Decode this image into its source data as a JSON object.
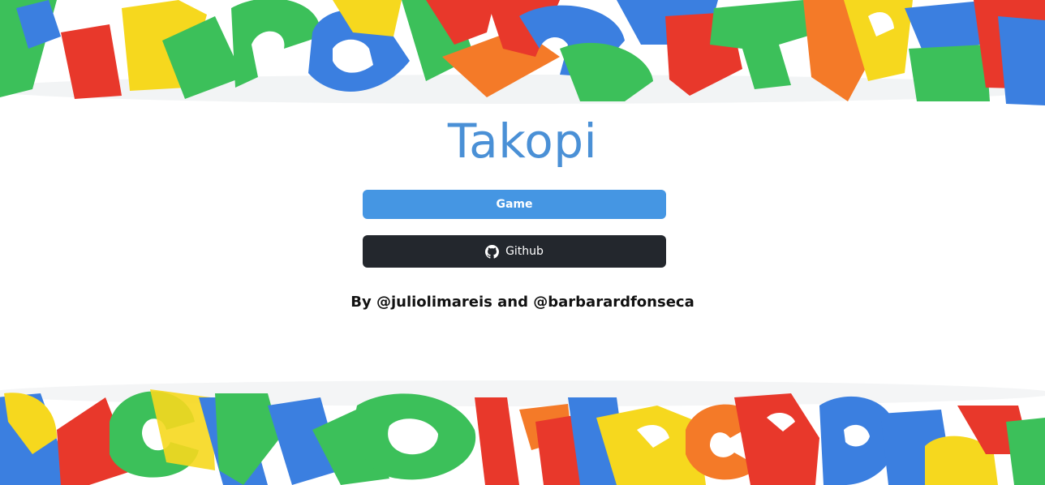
{
  "page": {
    "title": "Takopi",
    "game_button_label": "Game",
    "github_button_label": "Github",
    "github_icon": "github-icon",
    "byline": "By @juliolimareis and @barbarardfonseca"
  },
  "colors": {
    "title": "#4a90d6",
    "game_button": "#4596e3",
    "github_button": "#23272d",
    "letter_green": "#3cc05a",
    "letter_blue": "#3b7fe0",
    "letter_red": "#e8382b",
    "letter_yellow": "#f6d81e",
    "letter_orange": "#f47a28"
  }
}
